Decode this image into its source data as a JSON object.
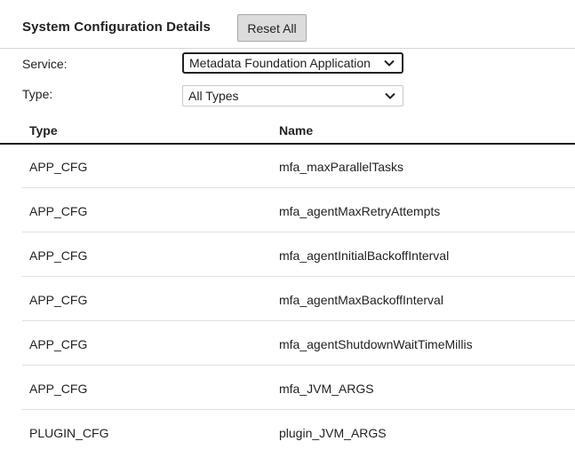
{
  "header": {
    "title": "System Configuration Details",
    "reset_label": "Reset All"
  },
  "filters": {
    "service_label": "Service:",
    "service_value": "Metadata Foundation Application",
    "type_label": "Type:",
    "type_value": "All Types"
  },
  "table": {
    "columns": [
      "Type",
      "Name"
    ],
    "rows": [
      {
        "type": "APP_CFG",
        "name": "mfa_maxParallelTasks"
      },
      {
        "type": "APP_CFG",
        "name": "mfa_agentMaxRetryAttempts"
      },
      {
        "type": "APP_CFG",
        "name": "mfa_agentInitialBackoffInterval"
      },
      {
        "type": "APP_CFG",
        "name": "mfa_agentMaxBackoffInterval"
      },
      {
        "type": "APP_CFG",
        "name": "mfa_agentShutdownWaitTimeMillis"
      },
      {
        "type": "APP_CFG",
        "name": "mfa_JVM_ARGS"
      },
      {
        "type": "PLUGIN_CFG",
        "name": "plugin_JVM_ARGS"
      }
    ]
  },
  "icons": {
    "service_dropdown": "chevron-down-icon",
    "type_dropdown": "chevron-down-icon"
  }
}
